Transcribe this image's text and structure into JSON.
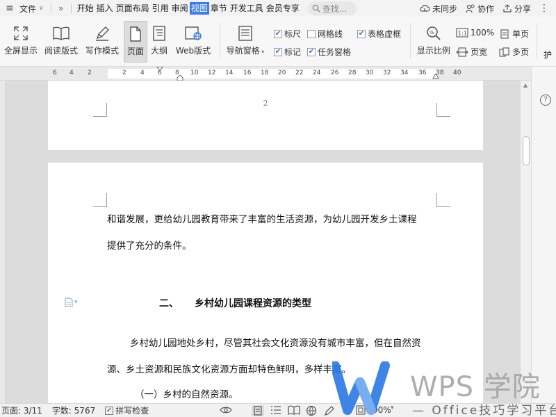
{
  "menubar": {
    "file_label": "文件",
    "tabs": [
      "开始",
      "插入",
      "页面布局",
      "引用",
      "审阅",
      "视图",
      "章节",
      "开发工具",
      "会员专享"
    ],
    "active_tab": "视图",
    "search_placeholder": "查找...",
    "right": {
      "sync": "未同步",
      "collab": "协作",
      "share": "分享"
    }
  },
  "ribbon": {
    "fullscreen": "全屏显示",
    "reading": "阅读版式",
    "writing": "写作模式",
    "page": "页面",
    "outline": "大纲",
    "web": "Web版式",
    "nav_pane": "导航窗格",
    "checks": {
      "ruler": "标尺",
      "gridlines": "网格线",
      "table_gridlines": "表格虚框",
      "marks": "标记",
      "task_pane": "任务窗格"
    },
    "zoom_label": "显示比例",
    "zoom_100": "100%",
    "page_width": "页宽",
    "single_page": "单页",
    "multi_page": "多页",
    "overflow": "护"
  },
  "ruler": {
    "numbers": [
      "6",
      "4",
      "2",
      "2",
      "4",
      "6",
      "8",
      "10",
      "12",
      "14",
      "16",
      "18",
      "20",
      "22",
      "24",
      "26",
      "28",
      "30",
      "32",
      "34",
      "36",
      "38",
      "40"
    ]
  },
  "document": {
    "page_number": "2",
    "line1": "和谐发展，更给幼儿园教育带来了丰富的生活资源，为幼儿园开发乡土课程",
    "line2": "提供了充分的条件。",
    "heading_num": "二、",
    "heading_text": "乡村幼儿园课程资源的类型",
    "line3": "乡村幼儿园地处乡村，尽管其社会文化资源没有城市丰富，但在自然资",
    "line4": "源、乡土资源和民族文化资源方面却特色鲜明，多样丰富。",
    "line5": "（一）乡村的自然资源。"
  },
  "statusbar": {
    "page": "页面: 3/11",
    "words": "字数: 5767",
    "spellcheck": "拼写检查",
    "zoom": "90%"
  },
  "watermark": {
    "title": "WPS 学院",
    "subtitle": "Office技巧学习平台"
  },
  "colors": {
    "accent": "#3d7ce8",
    "watermark_blue": "#2f7ae5"
  }
}
